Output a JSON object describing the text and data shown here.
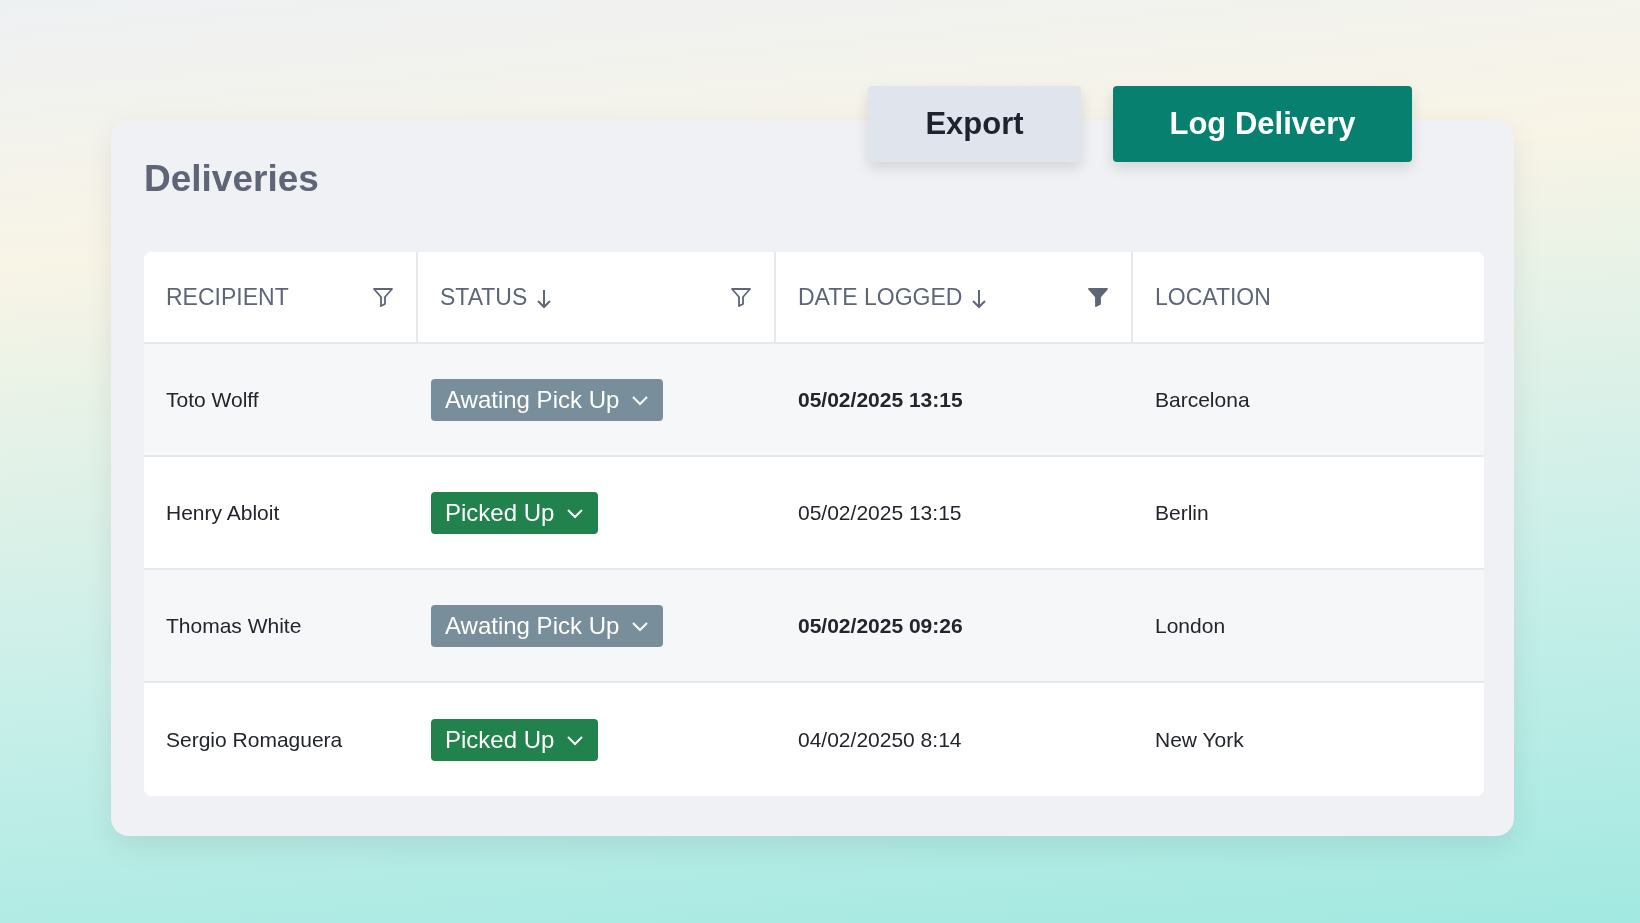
{
  "title": "Deliveries",
  "actions": [
    {
      "label": "Export",
      "kind": "secondary"
    },
    {
      "label": "Log Delivery",
      "kind": "primary"
    }
  ],
  "table": {
    "columns": [
      {
        "label": "RECIPIENT",
        "sorted": false,
        "filter_active": false
      },
      {
        "label": "STATUS",
        "sorted": true,
        "filter_active": false
      },
      {
        "label": "DATE LOGGED",
        "sorted": true,
        "filter_active": true
      },
      {
        "label": "LOCATION",
        "sorted": false
      }
    ],
    "rows": [
      {
        "recipient": "Toto Wolff",
        "status": {
          "label": "Awating Pick Up",
          "kind": "awaiting"
        },
        "date_logged": "05/02/2025 13:15",
        "location": "Barcelona",
        "highlighted": true
      },
      {
        "recipient": "Henry Abloit",
        "status": {
          "label": "Picked Up",
          "kind": "picked_up"
        },
        "date_logged": "05/02/2025 13:15",
        "location": "Berlin",
        "highlighted": false
      },
      {
        "recipient": "Thomas White",
        "status": {
          "label": "Awating Pick Up",
          "kind": "awaiting"
        },
        "date_logged": "05/02/2025 09:26",
        "location": "London",
        "highlighted": true
      },
      {
        "recipient": "Sergio Romaguera",
        "status": {
          "label": "Picked Up",
          "kind": "picked_up"
        },
        "date_logged": "04/02/20250 8:14",
        "location": "New York",
        "highlighted": false
      }
    ]
  }
}
